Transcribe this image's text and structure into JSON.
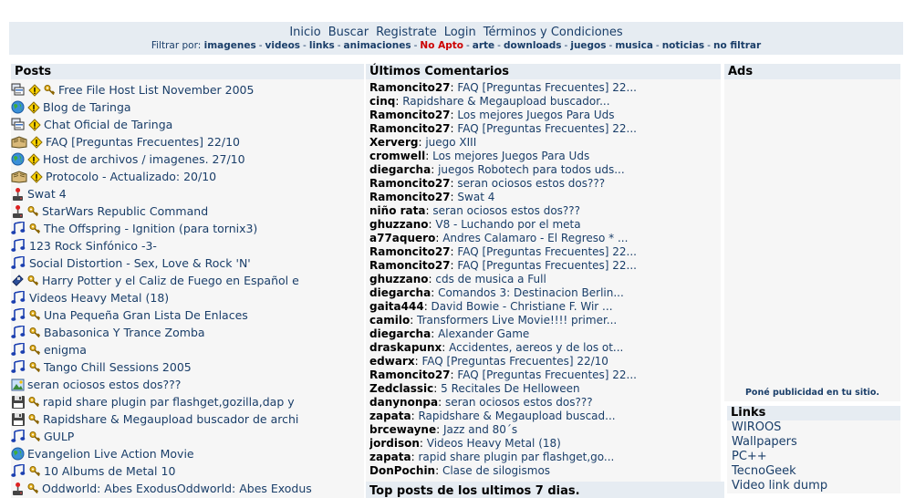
{
  "nav": {
    "items": [
      "Inicio",
      "Buscar",
      "Registrate",
      "Login",
      "Términos y Condiciones"
    ]
  },
  "filters": {
    "label": "Filtrar por:",
    "items": [
      "imagenes",
      "videos",
      "links",
      "animaciones",
      "No Apto",
      "arte",
      "downloads",
      "juegos",
      "musica",
      "noticias",
      "no filtrar"
    ],
    "highlight_color": "#cc0000"
  },
  "posts": {
    "title": "Posts",
    "items": [
      {
        "icons": [
          "apps-icon",
          "warning-icon",
          "key-icon"
        ],
        "label": "Free File Host List November 2005"
      },
      {
        "icons": [
          "globe-icon",
          "warning-icon"
        ],
        "label": "Blog de Taringa"
      },
      {
        "icons": [
          "apps-icon",
          "warning-icon"
        ],
        "label": "Chat Oficial de Taringa"
      },
      {
        "icons": [
          "book-icon",
          "warning-icon"
        ],
        "label": "FAQ [Preguntas Frecuentes] 22/10"
      },
      {
        "icons": [
          "globe-icon",
          "warning-icon"
        ],
        "label": "Host de archivos / imagenes. 27/10"
      },
      {
        "icons": [
          "book-icon",
          "warning-icon"
        ],
        "label": "Protocolo - Actualizado: 20/10"
      },
      {
        "icons": [
          "joystick-icon"
        ],
        "label": "Swat 4"
      },
      {
        "icons": [
          "joystick-icon",
          "key-icon"
        ],
        "label": "StarWars Republic Command"
      },
      {
        "icons": [
          "music-note-icon",
          "key-icon"
        ],
        "label": "The Offspring - Ignition (para tornix3)"
      },
      {
        "icons": [
          "music-note-icon"
        ],
        "label": "123 Rock Sinfónico -3-"
      },
      {
        "icons": [
          "music-note-icon"
        ],
        "label": "Social Distortion - Sex, Love & Rock 'N'"
      },
      {
        "icons": [
          "disc-icon",
          "key-icon"
        ],
        "label": "Harry Potter y el Caliz de Fuego en Español e"
      },
      {
        "icons": [
          "music-note-icon"
        ],
        "label": "Videos Heavy Metal (18)"
      },
      {
        "icons": [
          "music-note-icon",
          "key-icon"
        ],
        "label": "Una Pequeña Gran Lista De Enlaces"
      },
      {
        "icons": [
          "music-note-icon",
          "key-icon"
        ],
        "label": "Babasonica Y Trance Zomba"
      },
      {
        "icons": [
          "music-note-icon",
          "key-icon"
        ],
        "label": "enigma"
      },
      {
        "icons": [
          "music-note-icon",
          "key-icon"
        ],
        "label": "Tango Chill Sessions 2005"
      },
      {
        "icons": [
          "picture-icon"
        ],
        "label": "seran ociosos estos dos???"
      },
      {
        "icons": [
          "floppy-icon",
          "key-icon"
        ],
        "label": "rapid share plugin par flashget,gozilla,dap y"
      },
      {
        "icons": [
          "floppy-icon",
          "key-icon"
        ],
        "label": "Rapidshare & Megaupload buscador de archi"
      },
      {
        "icons": [
          "music-note-icon",
          "key-icon"
        ],
        "label": "GULP"
      },
      {
        "icons": [
          "globe-icon"
        ],
        "label": "Evangelion Live Action Movie"
      },
      {
        "icons": [
          "music-note-icon",
          "key-icon"
        ],
        "label": "10 Albums de Metal 10"
      },
      {
        "icons": [
          "joystick-icon",
          "key-icon"
        ],
        "label": "Oddworld: Abes ExodusOddworld: Abes Exodus"
      }
    ]
  },
  "comments": {
    "title": "Últimos Comentarios",
    "items": [
      {
        "user": "Ramoncito27",
        "title": "FAQ [Preguntas Frecuentes] 22..."
      },
      {
        "user": "cinq",
        "title": "Rapidshare & Megaupload buscador..."
      },
      {
        "user": "Ramoncito27",
        "title": "Los mejores Juegos Para Uds"
      },
      {
        "user": "Ramoncito27",
        "title": "FAQ [Preguntas Frecuentes] 22..."
      },
      {
        "user": "Xerverg",
        "title": "juego XIII"
      },
      {
        "user": "cromwell",
        "title": "Los mejores Juegos Para Uds"
      },
      {
        "user": "diegarcha",
        "title": "juegos Robotech para todos uds..."
      },
      {
        "user": "Ramoncito27",
        "title": "seran ociosos estos dos???"
      },
      {
        "user": "Ramoncito27",
        "title": "Swat 4"
      },
      {
        "user": "niño rata",
        "title": "seran ociosos estos dos???"
      },
      {
        "user": "ghuzzano",
        "title": "V8 - Luchando por el meta"
      },
      {
        "user": "a77aquero",
        "title": "Andres Calamaro - El Regreso * ..."
      },
      {
        "user": "Ramoncito27",
        "title": "FAQ [Preguntas Frecuentes] 22..."
      },
      {
        "user": "Ramoncito27",
        "title": "FAQ [Preguntas Frecuentes] 22..."
      },
      {
        "user": "ghuzzano",
        "title": "cds de musica a Full"
      },
      {
        "user": "diegarcha",
        "title": "Comandos 3: Destinacion Berlin..."
      },
      {
        "user": "gaita444",
        "title": "David Bowie - Christiane F. Wir ..."
      },
      {
        "user": "camilo",
        "title": "Transformers Live Movie!!!! primer..."
      },
      {
        "user": "diegarcha",
        "title": "Alexander Game"
      },
      {
        "user": "draskapunx",
        "title": "Accidentes, aereos y de los ot..."
      },
      {
        "user": "edwarx",
        "title": "FAQ [Preguntas Frecuentes] 22/10"
      },
      {
        "user": "Ramoncito27",
        "title": "FAQ [Preguntas Frecuentes] 22..."
      },
      {
        "user": "Zedclassic",
        "title": "5 Recitales De Helloween"
      },
      {
        "user": "danynonpa",
        "title": "seran ociosos estos dos???"
      },
      {
        "user": "zapata",
        "title": "Rapidshare & Megaupload buscad..."
      },
      {
        "user": "brcewayne",
        "title": "Jazz and 80´s"
      },
      {
        "user": "jordison",
        "title": "Videos Heavy Metal (18)"
      },
      {
        "user": "zapata",
        "title": "rapid share plugin par flashget,go..."
      },
      {
        "user": "DonPochin",
        "title": "Clase de silogismos"
      }
    ],
    "top7_title": "Top posts de los ultimos 7 dias."
  },
  "ads": {
    "title": "Ads",
    "promo": "Poné publicidad en tu sitio."
  },
  "links": {
    "title": "Links",
    "items": [
      "WIROOS",
      "Wallpapers",
      "PC++",
      "TecnoGeek",
      "Video link dump"
    ]
  },
  "colors": {
    "link": "#1a3e69",
    "header_bg": "#e6ecf2",
    "panel_bg": "#f6f6f6",
    "alert": "#cc0000"
  }
}
